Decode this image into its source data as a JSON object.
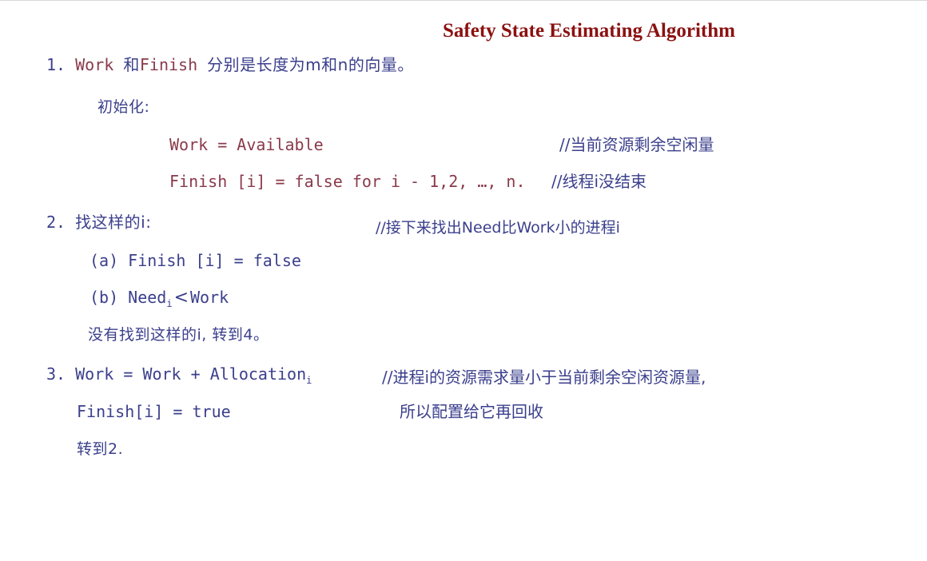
{
  "title": "Safety State Estimating Algorithm",
  "step1": {
    "num": "1.",
    "work": "Work",
    "he": "和",
    "finish": "Finish",
    "rest": "分别是长度为m和n的向量。"
  },
  "init": {
    "label": "初始化:",
    "work_line": "Work = Available",
    "work_comment": "//当前资源剩余空闲量",
    "finish_line": "Finish [i] = false for i  - 1,2, …,  n.",
    "finish_comment": "//线程i没结束"
  },
  "step2": {
    "num": "2.",
    "label": "找这样的i:",
    "comment": "//接下来找出Need比Work小的进程i",
    "a": "(a) Finish [i] = false",
    "b_prefix": "(b) Need",
    "b_sub": "i",
    "b_op": "<",
    "b_suffix": "Work",
    "notfound": "没有找到这样的i, 转到4。"
  },
  "step3": {
    "num": "3.",
    "line1_prefix": "Work = Work + Allocation",
    "line1_sub": "i",
    "comment1": "//进程i的资源需求量小于当前剩余空闲资源量,",
    "line2": "Finish[i] = true",
    "comment2": "所以配置给它再回收",
    "goto": "转到2."
  }
}
